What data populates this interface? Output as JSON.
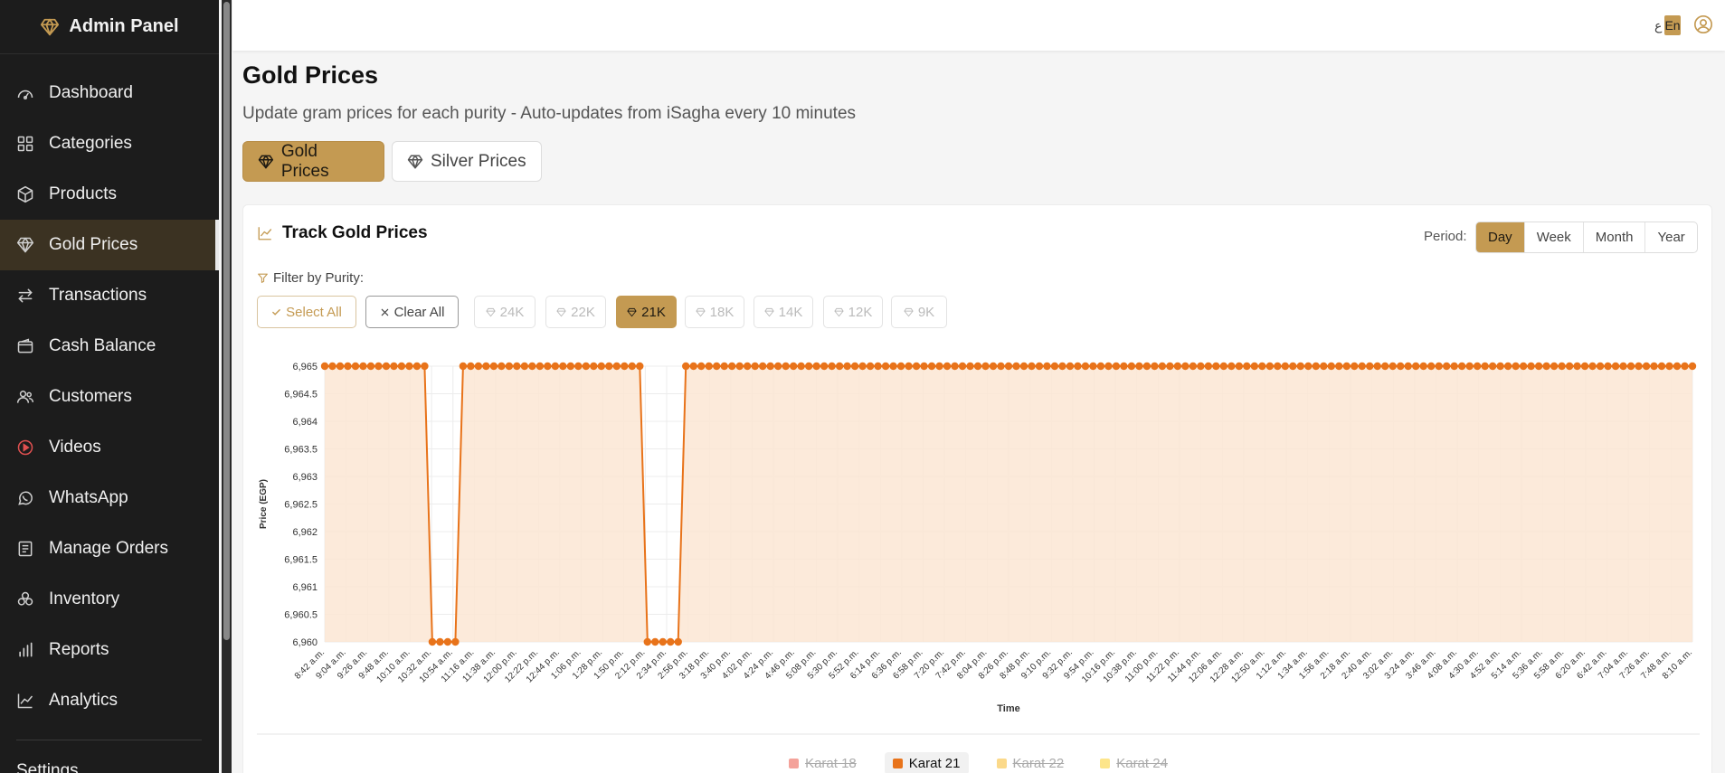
{
  "sidebar": {
    "brand": "Admin Panel",
    "items": [
      {
        "label": "Dashboard",
        "icon": "dashboard-icon"
      },
      {
        "label": "Categories",
        "icon": "grid-icon"
      },
      {
        "label": "Products",
        "icon": "box-icon"
      },
      {
        "label": "Gold Prices",
        "icon": "diamond-icon",
        "active": true
      },
      {
        "label": "Transactions",
        "icon": "arrows-icon"
      },
      {
        "label": "Cash Balance",
        "icon": "wallet-icon"
      },
      {
        "label": "Customers",
        "icon": "users-icon"
      },
      {
        "label": "Videos",
        "icon": "play-icon"
      },
      {
        "label": "WhatsApp",
        "icon": "whatsapp-icon"
      },
      {
        "label": "Manage Orders",
        "icon": "orders-icon"
      },
      {
        "label": "Inventory",
        "icon": "inventory-icon"
      },
      {
        "label": "Reports",
        "icon": "bars-icon"
      },
      {
        "label": "Analytics",
        "icon": "trend-icon"
      }
    ],
    "cut_item": "Settings"
  },
  "topbar": {
    "lang_ar": "ع",
    "lang_en": "En"
  },
  "page": {
    "title": "Gold Prices",
    "subtitle": "Update gram prices for each purity - Auto-updates from iSagha every 10 minutes",
    "tabs": {
      "gold": "Gold Prices",
      "silver": "Silver Prices"
    }
  },
  "card": {
    "title": "Track Gold Prices",
    "period_label": "Period:",
    "periods": [
      "Day",
      "Week",
      "Month",
      "Year"
    ],
    "active_period": "Day",
    "filter_label": "Filter by Purity:",
    "select_all": "Select All",
    "clear_all": "Clear All",
    "purities": [
      "24K",
      "22K",
      "21K",
      "18K",
      "14K",
      "12K",
      "9K"
    ],
    "active_purity": "21K"
  },
  "colors": {
    "accent": "#c49a52",
    "line": "#e8731a",
    "fill": "#fbe6d3"
  },
  "chart_data": {
    "type": "area",
    "title": "",
    "xlabel": "Time",
    "ylabel": "Price (EGP)",
    "ylim": [
      6960,
      6965
    ],
    "yticks": [
      "6,965",
      "6,964.5",
      "6,964",
      "6,963.5",
      "6,963",
      "6,962.5",
      "6,962",
      "6,961.5",
      "6,961",
      "6,960.5",
      "6,960"
    ],
    "xticks": [
      "8:42 a.m.",
      "9:04 a.m.",
      "9:26 a.m.",
      "9:48 a.m.",
      "10:10 a.m.",
      "10:32 a.m.",
      "10:54 a.m.",
      "11:16 a.m.",
      "11:38 a.m.",
      "12:00 p.m.",
      "12:22 p.m.",
      "12:44 p.m.",
      "1:06 p.m.",
      "1:28 p.m.",
      "1:50 p.m.",
      "2:12 p.m.",
      "2:34 p.m.",
      "2:56 p.m.",
      "3:18 p.m.",
      "3:40 p.m.",
      "4:02 p.m.",
      "4:24 p.m.",
      "4:46 p.m.",
      "5:08 p.m.",
      "5:30 p.m.",
      "5:52 p.m.",
      "6:14 p.m.",
      "6:36 p.m.",
      "6:58 p.m.",
      "7:20 p.m.",
      "7:42 p.m.",
      "8:04 p.m.",
      "8:26 p.m.",
      "8:48 p.m.",
      "9:10 p.m.",
      "9:32 p.m.",
      "9:54 p.m.",
      "10:16 p.m.",
      "10:38 p.m.",
      "11:00 p.m.",
      "11:22 p.m.",
      "11:44 p.m.",
      "12:06 a.m.",
      "12:28 a.m.",
      "12:50 a.m.",
      "1:12 a.m.",
      "1:34 a.m.",
      "1:56 a.m.",
      "2:18 a.m.",
      "2:40 a.m.",
      "3:02 a.m.",
      "3:24 a.m.",
      "3:46 a.m.",
      "4:08 a.m.",
      "4:30 a.m.",
      "4:52 a.m.",
      "5:14 a.m.",
      "5:36 a.m.",
      "5:58 a.m.",
      "6:20 a.m.",
      "6:42 a.m.",
      "7:04 a.m.",
      "7:26 a.m.",
      "7:48 a.m.",
      "8:10 a.m."
    ],
    "series": [
      {
        "name": "Karat 21",
        "values": [
          6965,
          6965,
          6965,
          6965,
          6965,
          6965,
          6965,
          6965,
          6965,
          6965,
          6965,
          6965,
          6965,
          6965,
          6960,
          6960,
          6960,
          6960,
          6965,
          6965,
          6965,
          6965,
          6965,
          6965,
          6965,
          6965,
          6965,
          6965,
          6965,
          6965,
          6965,
          6965,
          6965,
          6965,
          6965,
          6965,
          6965,
          6965,
          6965,
          6965,
          6965,
          6965,
          6960,
          6960,
          6960,
          6960,
          6960,
          6965,
          6965,
          6965,
          6965,
          6965,
          6965,
          6965,
          6965,
          6965,
          6965,
          6965,
          6965,
          6965,
          6965,
          6965,
          6965,
          6965,
          6965,
          6965,
          6965,
          6965,
          6965,
          6965,
          6965,
          6965,
          6965,
          6965,
          6965,
          6965,
          6965,
          6965,
          6965,
          6965,
          6965,
          6965,
          6965,
          6965,
          6965,
          6965,
          6965,
          6965,
          6965,
          6965,
          6965,
          6965,
          6965,
          6965,
          6965,
          6965,
          6965,
          6965,
          6965,
          6965,
          6965,
          6965,
          6965,
          6965,
          6965,
          6965,
          6965,
          6965,
          6965,
          6965,
          6965,
          6965,
          6965,
          6965,
          6965,
          6965,
          6965,
          6965,
          6965,
          6965,
          6965,
          6965,
          6965,
          6965,
          6965,
          6965,
          6965,
          6965,
          6965,
          6965,
          6965,
          6965,
          6965,
          6965,
          6965,
          6965,
          6965,
          6965,
          6965,
          6965,
          6965,
          6965,
          6965,
          6965,
          6965,
          6965,
          6965,
          6965,
          6965,
          6965,
          6965,
          6965,
          6965,
          6965,
          6965,
          6965,
          6965,
          6965,
          6965,
          6965,
          6965,
          6965,
          6965,
          6965,
          6965,
          6965,
          6965,
          6965,
          6965,
          6965,
          6965,
          6965,
          6965,
          6965,
          6965,
          6965,
          6965,
          6965,
          6965
        ]
      }
    ],
    "legend": [
      {
        "name": "Karat 18",
        "color": "#f4a29a",
        "enabled": false
      },
      {
        "name": "Karat 21",
        "color": "#e8731a",
        "enabled": true
      },
      {
        "name": "Karat 22",
        "color": "#fbd98a",
        "enabled": false
      },
      {
        "name": "Karat 24",
        "color": "#fde58a",
        "enabled": false
      }
    ]
  }
}
